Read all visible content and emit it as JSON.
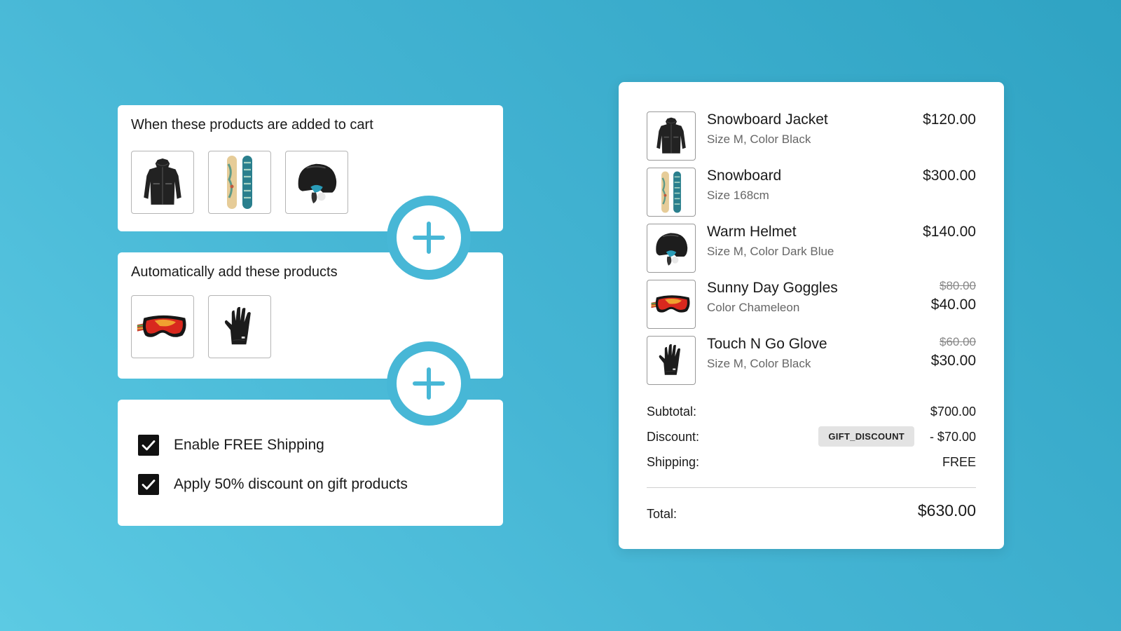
{
  "colors": {
    "accent": "#47b7d6",
    "background_start": "#5ccae3",
    "background_end": "#2fa3c3"
  },
  "trigger_card": {
    "title": "When these products are added to cart",
    "products": [
      "snowboard-jacket-image",
      "snowboard-image",
      "helmet-image"
    ]
  },
  "auto_add_card": {
    "title": "Automatically add these products",
    "products": [
      "goggles-image",
      "glove-image"
    ]
  },
  "options_card": {
    "options": [
      {
        "label": "Enable FREE Shipping",
        "checked": true
      },
      {
        "label": "Apply 50% discount on gift products",
        "checked": true
      }
    ]
  },
  "cart": {
    "items": [
      {
        "name": "Snowboard Jacket",
        "variant": "Size M, Color Black",
        "price": "$120.00",
        "icon": "snowboard-jacket-image"
      },
      {
        "name": "Snowboard",
        "variant": "Size 168cm",
        "price": "$300.00",
        "icon": "snowboard-image"
      },
      {
        "name": "Warm Helmet",
        "variant": "Size M, Color Dark Blue",
        "price": "$140.00",
        "icon": "helmet-image"
      },
      {
        "name": "Sunny Day Goggles",
        "variant": "Color Chameleon",
        "old_price": "$80.00",
        "price": "$40.00",
        "icon": "goggles-image"
      },
      {
        "name": "Touch N Go Glove",
        "variant": "Size M, Color Black",
        "old_price": "$60.00",
        "price": "$30.00",
        "icon": "glove-image"
      }
    ],
    "summary": {
      "subtotal_label": "Subtotal:",
      "subtotal_value": "$700.00",
      "discount_label": "Discount:",
      "discount_code": "GIFT_DISCOUNT",
      "discount_value": "- $70.00",
      "shipping_label": "Shipping:",
      "shipping_value": "FREE",
      "total_label": "Total:",
      "total_value": "$630.00"
    }
  }
}
